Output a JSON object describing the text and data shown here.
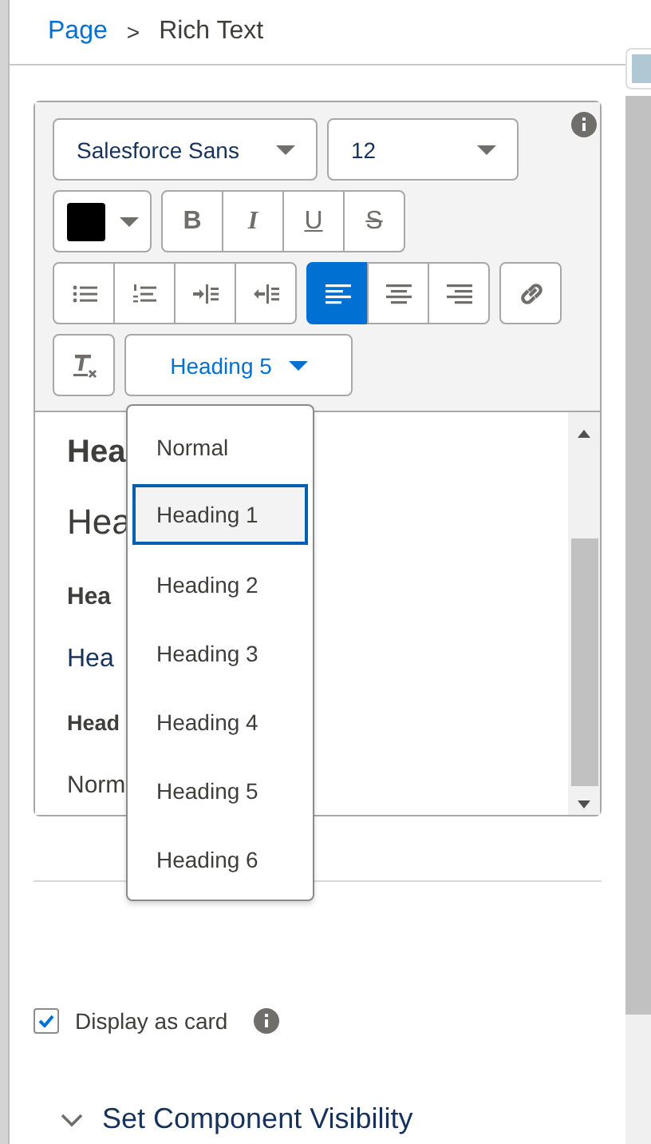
{
  "breadcrumb": {
    "separator": ">",
    "items": [
      {
        "label": "Page",
        "kind": "link"
      },
      {
        "label": "Rich Text",
        "kind": "current"
      }
    ]
  },
  "toolbar": {
    "font": {
      "value": "Salesforce Sans"
    },
    "size": {
      "value": "12"
    },
    "text_color": {
      "color": "#000000"
    },
    "format_buttons": [
      {
        "kind": "bold",
        "label": "B"
      },
      {
        "kind": "italic",
        "label": "I"
      },
      {
        "kind": "underline",
        "label": "U"
      },
      {
        "kind": "strike",
        "label": "S"
      }
    ],
    "list_buttons": [
      {
        "kind": "bullets"
      },
      {
        "kind": "numbers"
      },
      {
        "kind": "indent"
      },
      {
        "kind": "outdent"
      }
    ],
    "align_buttons": [
      {
        "kind": "left",
        "selected": true
      },
      {
        "kind": "center",
        "selected": false
      },
      {
        "kind": "right",
        "selected": false
      }
    ],
    "heading": {
      "value": "Heading 5"
    }
  },
  "editor": {
    "lines": [
      {
        "kind": "h1",
        "text": "Hea"
      },
      {
        "kind": "h2",
        "text": "Hea"
      },
      {
        "kind": "h3",
        "text": "Hea"
      },
      {
        "kind": "h4",
        "text": "Hea"
      },
      {
        "kind": "h5",
        "text": "Head"
      },
      {
        "kind": "normal",
        "text": "Norm"
      }
    ]
  },
  "heading_menu": {
    "options": [
      {
        "label": "Normal",
        "selected": false
      },
      {
        "label": "Heading 1",
        "selected": true
      },
      {
        "label": "Heading 2",
        "selected": false
      },
      {
        "label": "Heading 3",
        "selected": false
      },
      {
        "label": "Heading 4",
        "selected": false
      },
      {
        "label": "Heading 5",
        "selected": false
      },
      {
        "label": "Heading 6",
        "selected": false
      }
    ]
  },
  "display_as_card": {
    "label": "Display as card",
    "checked": true
  },
  "section": {
    "label": "Set Component Visibility",
    "expanded": true
  }
}
